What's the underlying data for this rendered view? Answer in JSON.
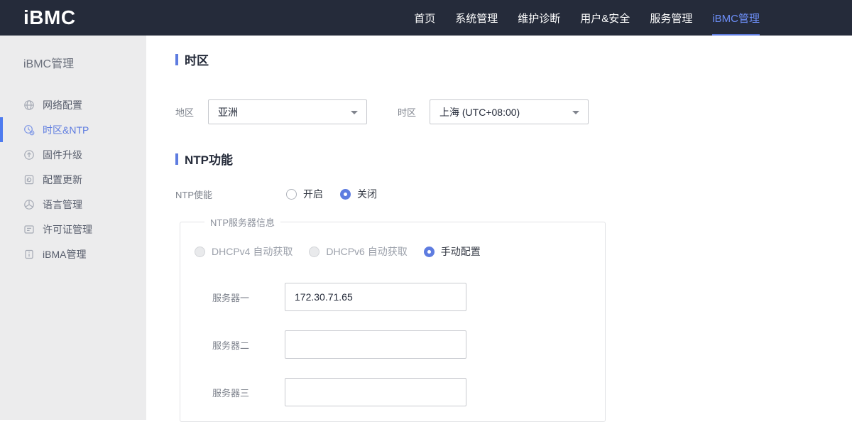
{
  "brand": {
    "logo": "iBMC"
  },
  "topnav": {
    "items": [
      {
        "label": "首页",
        "active": false
      },
      {
        "label": "系统管理",
        "active": false
      },
      {
        "label": "维护诊断",
        "active": false
      },
      {
        "label": "用户&安全",
        "active": false
      },
      {
        "label": "服务管理",
        "active": false
      },
      {
        "label": "iBMC管理",
        "active": true
      }
    ]
  },
  "sidebar": {
    "title": "iBMC管理",
    "items": [
      {
        "label": "网络配置",
        "icon": "network-icon",
        "active": false
      },
      {
        "label": "时区&NTP",
        "icon": "timezone-icon",
        "active": true
      },
      {
        "label": "固件升级",
        "icon": "firmware-upgrade-icon",
        "active": false
      },
      {
        "label": "配置更新",
        "icon": "config-update-icon",
        "active": false
      },
      {
        "label": "语言管理",
        "icon": "language-icon",
        "active": false
      },
      {
        "label": "许可证管理",
        "icon": "license-icon",
        "active": false
      },
      {
        "label": "iBMA管理",
        "icon": "ibma-icon",
        "active": false
      }
    ]
  },
  "timezone_section": {
    "title": "时区",
    "region_label": "地区",
    "region_value": "亚洲",
    "timezone_label": "时区",
    "timezone_value": "上海 (UTC+08:00)"
  },
  "ntp_section": {
    "title": "NTP功能",
    "enable_label": "NTP使能",
    "enable_options": [
      {
        "label": "开启",
        "selected": false
      },
      {
        "label": "关闭",
        "selected": true
      }
    ],
    "server_group": {
      "legend": "NTP服务器信息",
      "mode_options": [
        {
          "label": "DHCPv4 自动获取",
          "selected": false,
          "disabled": true
        },
        {
          "label": "DHCPv6 自动获取",
          "selected": false,
          "disabled": true
        },
        {
          "label": "手动配置",
          "selected": true,
          "disabled": false
        }
      ],
      "servers": [
        {
          "label": "服务器一",
          "value": "172.30.71.65"
        },
        {
          "label": "服务器二",
          "value": ""
        },
        {
          "label": "服务器三",
          "value": ""
        }
      ]
    }
  },
  "colors": {
    "accent": "#5e7ce0",
    "navbar_bg": "#252b3a",
    "nav_active_text": "#6d8ff8",
    "sidebar_bg": "#eceded"
  }
}
